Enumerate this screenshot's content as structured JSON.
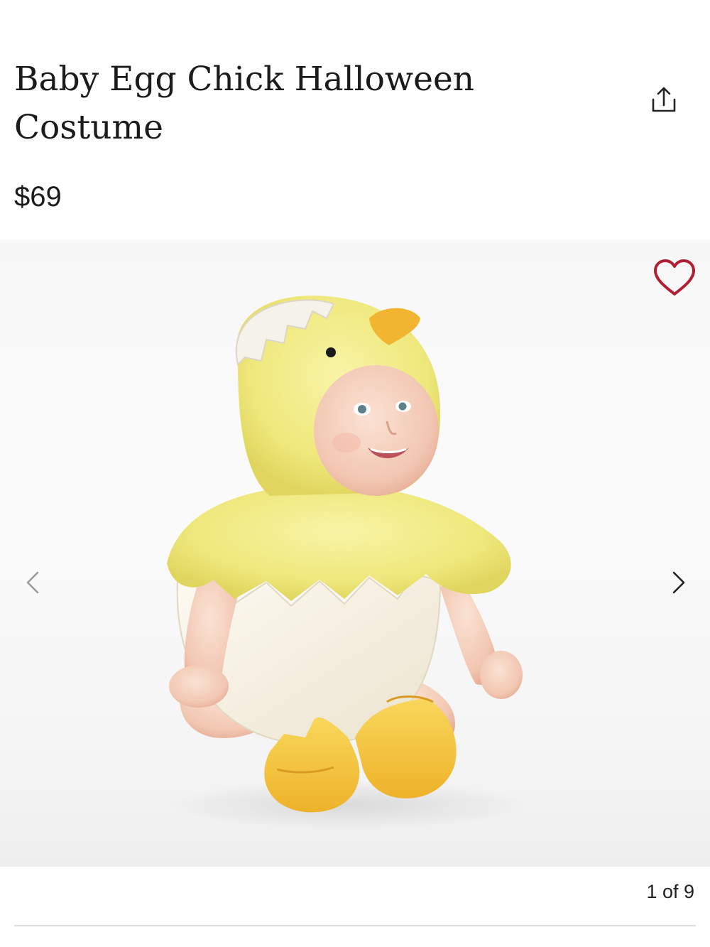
{
  "product": {
    "title": "Baby Egg Chick Halloween Costume",
    "price": "$69"
  },
  "actions": {
    "share_icon": "share-icon",
    "favorite_icon": "heart-outline-icon",
    "favorite_color": "#b11f32"
  },
  "gallery": {
    "image_description_icon": "product-photo",
    "prev_icon": "chevron-left-icon",
    "next_icon": "chevron-right-icon",
    "counter": "1 of 9"
  },
  "colors": {
    "chick_yellow": "#f3ec8a",
    "egg_white": "#f7f2e6",
    "beak_orange": "#f2b531",
    "feet_orange": "#f5c13a"
  }
}
